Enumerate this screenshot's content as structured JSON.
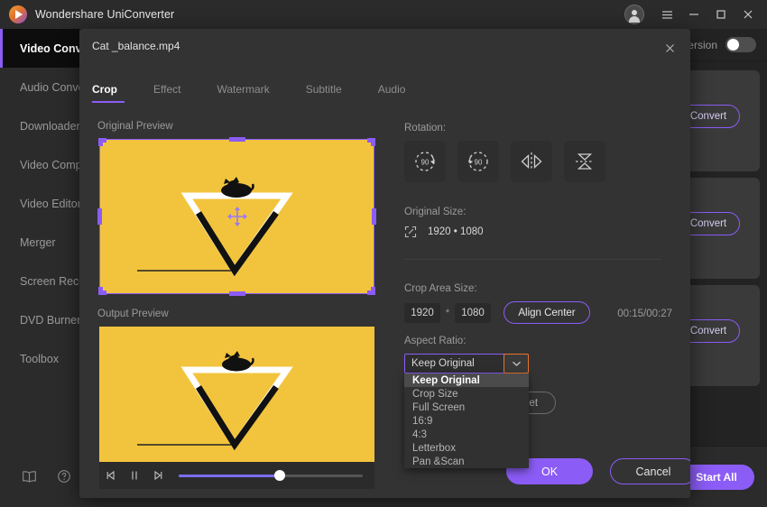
{
  "app": {
    "title": "Wondershare UniConverter",
    "logo_icon": "uniconverter-logo",
    "titlebar_buttons": {
      "account_icon": "account-avatar-icon",
      "menu_icon": "hamburger-menu-icon",
      "minimize_icon": "minimize-icon",
      "maximize_icon": "maximize-icon",
      "close_icon": "close-icon"
    }
  },
  "sidebar": {
    "items": [
      {
        "label": "Video Converter",
        "active": true
      },
      {
        "label": "Audio Converter",
        "active": false
      },
      {
        "label": "Downloader",
        "active": false
      },
      {
        "label": "Video Compressor",
        "active": false
      },
      {
        "label": "Video Editor",
        "active": false
      },
      {
        "label": "Merger",
        "active": false
      },
      {
        "label": "Screen Recorder",
        "active": false
      },
      {
        "label": "DVD Burner",
        "active": false
      },
      {
        "label": "Toolbox",
        "active": false
      }
    ],
    "bottom_icons": [
      {
        "name": "book-icon"
      },
      {
        "name": "help-icon"
      }
    ]
  },
  "main": {
    "conversion_toggle_label": "Conversion",
    "conversion_toggle_on": false,
    "cards": [
      {
        "convert_label": "Convert"
      },
      {
        "convert_label": "Convert"
      },
      {
        "convert_label": "Convert"
      }
    ],
    "start_all_label": "Start All"
  },
  "dialog": {
    "title": "Cat _balance.mp4",
    "close_icon": "close-icon",
    "tabs": [
      {
        "label": "Crop",
        "active": true
      },
      {
        "label": "Effect",
        "active": false
      },
      {
        "label": "Watermark",
        "active": false
      },
      {
        "label": "Subtitle",
        "active": false
      },
      {
        "label": "Audio",
        "active": false
      }
    ],
    "original_preview_label": "Original Preview",
    "output_preview_label": "Output Preview",
    "time_display": "00:15/00:27",
    "player": {
      "prev_frame_icon": "step-backward-icon",
      "pause_icon": "pause-icon",
      "next_frame_icon": "step-forward-icon",
      "progress_percent": 55
    },
    "rotation_label": "Rotation:",
    "rotation_buttons": [
      {
        "name": "rotate-right-90-icon",
        "label": "90"
      },
      {
        "name": "rotate-left-90-icon",
        "label": "90"
      },
      {
        "name": "flip-horizontal-icon",
        "label": ""
      },
      {
        "name": "flip-vertical-icon",
        "label": ""
      }
    ],
    "original_size_label": "Original Size:",
    "original_size_icon": "expand-icon",
    "original_size_value": "1920 • 1080",
    "crop_area_size_label": "Crop Area Size:",
    "crop_width": "1920",
    "crop_separator": "*",
    "crop_height": "1080",
    "align_center_label": "Align Center",
    "aspect_ratio_label": "Aspect Ratio:",
    "aspect_ratio_value": "Keep Original",
    "aspect_ratio_chevron_icon": "chevron-down-icon",
    "aspect_ratio_options": [
      {
        "label": "Keep Original",
        "selected": true
      },
      {
        "label": "Crop Size",
        "selected": false
      },
      {
        "label": "Full Screen",
        "selected": false
      },
      {
        "label": "16:9",
        "selected": false
      },
      {
        "label": "4:3",
        "selected": false
      },
      {
        "label": "Letterbox",
        "selected": false
      },
      {
        "label": "Pan &Scan",
        "selected": false
      }
    ],
    "reset_label": "Reset",
    "ok_label": "OK",
    "cancel_label": "Cancel"
  },
  "colors": {
    "accent_purple": "#8b5cf6",
    "highlight_orange": "#e8742c",
    "video_yellow": "#f2c43d",
    "window_bg": "#232323",
    "panel_bg": "#2b2b2b",
    "dialog_bg": "#333333"
  }
}
